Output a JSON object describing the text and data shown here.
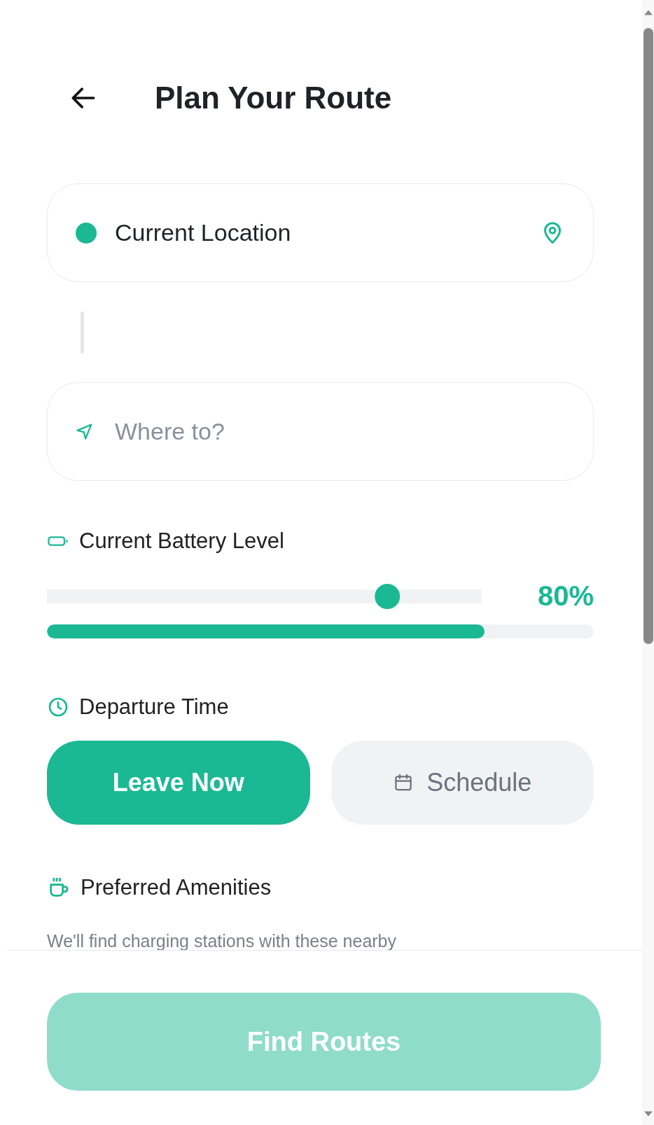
{
  "header": {
    "title": "Plan Your Route"
  },
  "origin": {
    "value": "Current Location"
  },
  "destination": {
    "placeholder": "Where to?"
  },
  "battery": {
    "label": "Current Battery Level",
    "level": 0.8,
    "reading": "80%"
  },
  "battery_bar": {
    "level": 0.8
  },
  "departure": {
    "label": "Departure Time",
    "options": [
      {
        "label": "Leave Now",
        "kind": "now",
        "selected": true
      },
      {
        "label": "Schedule",
        "kind": "schedule",
        "selected": false
      }
    ]
  },
  "amenities": {
    "label": "Preferred Amenities",
    "note": "We'll find charging stations with these nearby"
  },
  "footer": {
    "button": {
      "label": "Find Routes",
      "disabled": true
    }
  }
}
